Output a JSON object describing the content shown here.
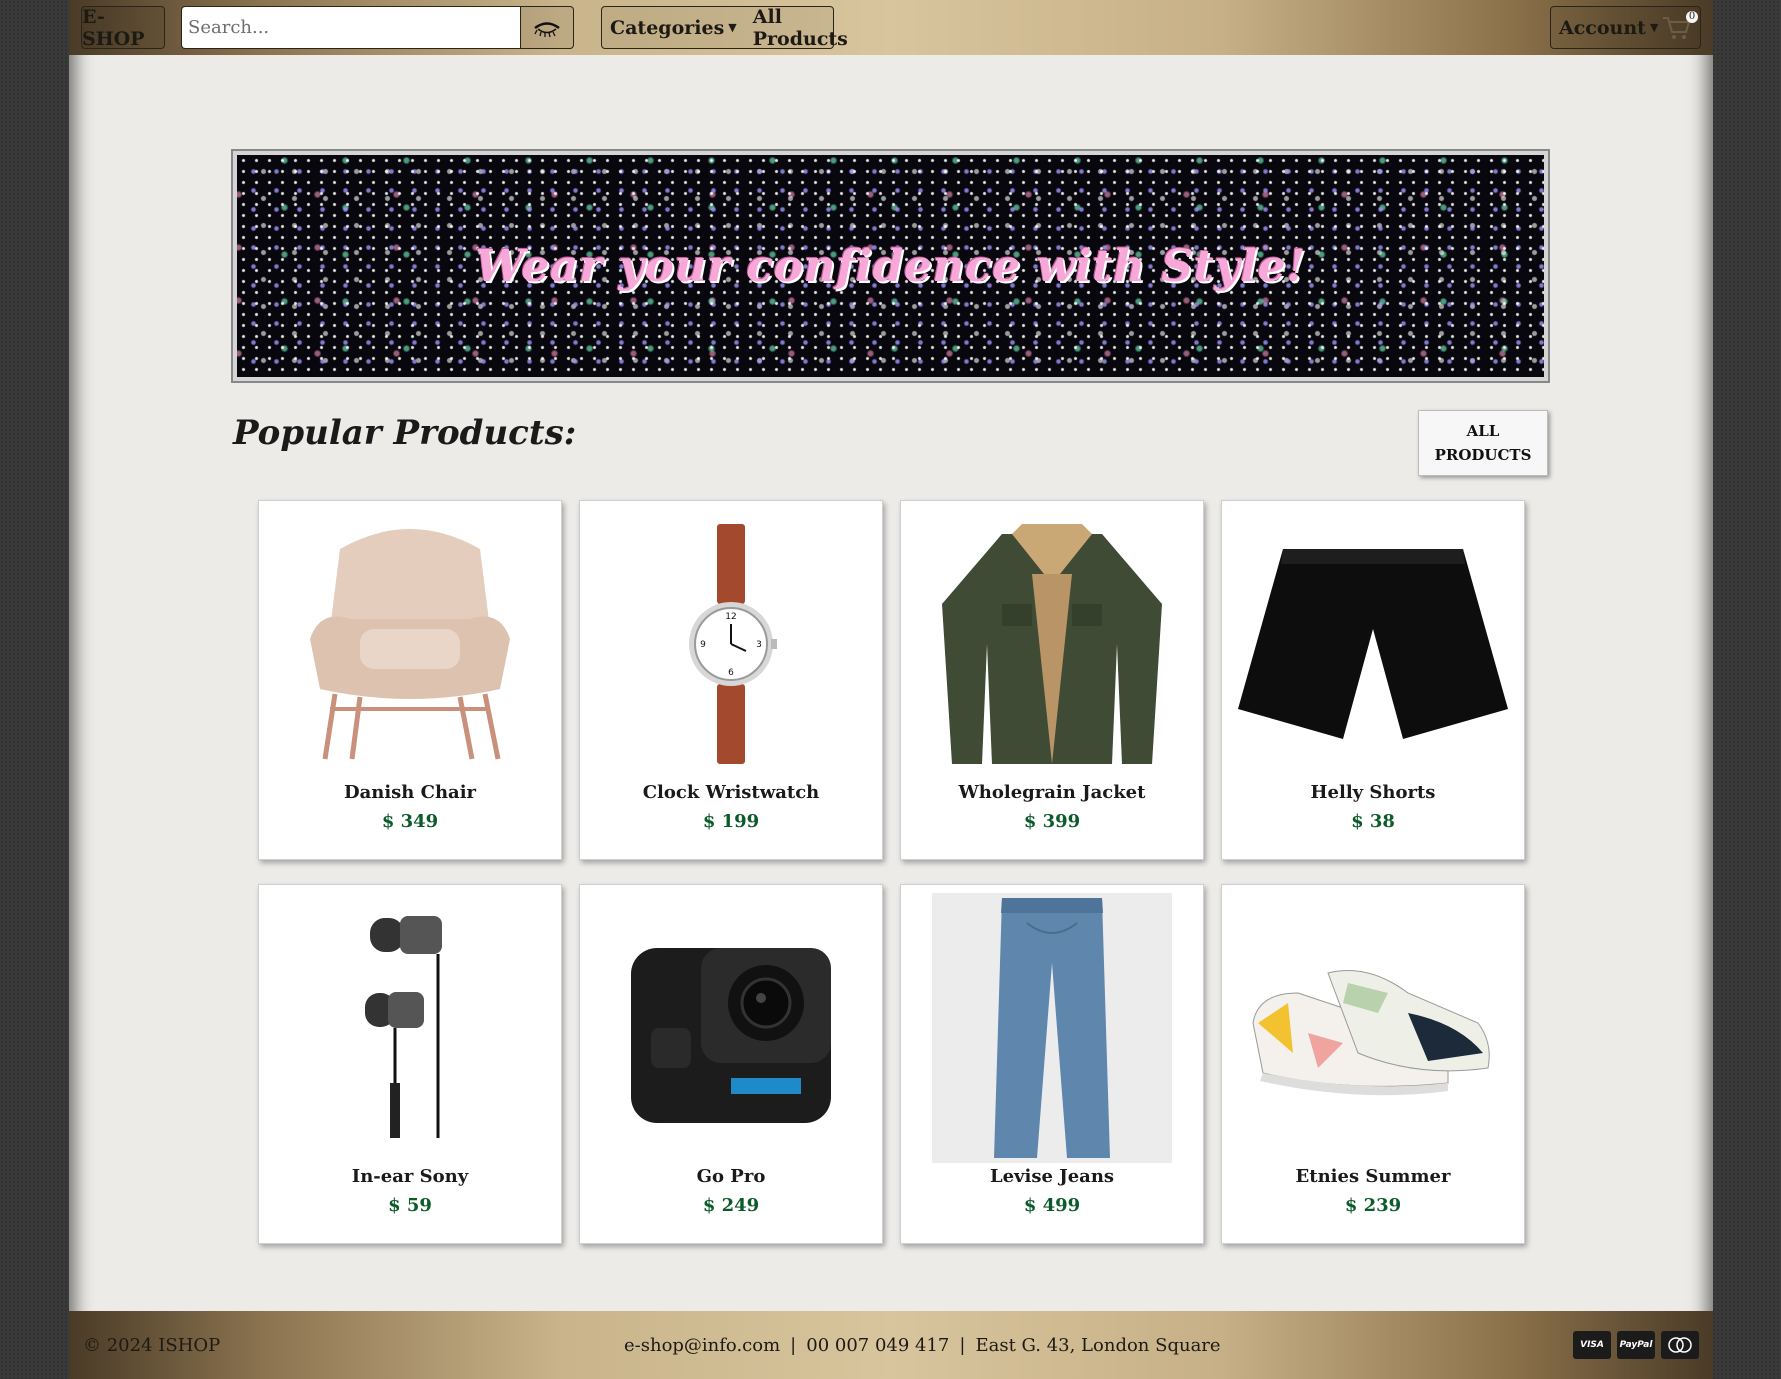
{
  "header": {
    "brand": "E-SHOP",
    "search_placeholder": "Search...",
    "search_icon": "eye-search-icon",
    "nav": {
      "categories": "Categories",
      "all_products": "All Products"
    },
    "account": "Account",
    "cart_count": "0"
  },
  "banner": {
    "tagline": "Wear your confidence with Style!"
  },
  "popular": {
    "title": "Popular Products:",
    "all_button": "ALL PRODUCTS",
    "products": [
      {
        "name": "Danish Chair",
        "price": "$ 349",
        "icon": "chair-image"
      },
      {
        "name": "Clock Wristwatch",
        "price": "$ 199",
        "icon": "watch-image"
      },
      {
        "name": "Wholegrain Jacket",
        "price": "$ 399",
        "icon": "jacket-image"
      },
      {
        "name": "Helly Shorts",
        "price": "$ 38",
        "icon": "shorts-image"
      },
      {
        "name": "In-ear Sony",
        "price": "$ 59",
        "icon": "earphones-image"
      },
      {
        "name": "Go Pro",
        "price": "$ 249",
        "icon": "camera-image"
      },
      {
        "name": "Levise Jeans",
        "price": "$ 499",
        "icon": "jeans-image"
      },
      {
        "name": "Etnies Summer",
        "price": "$ 239",
        "icon": "sneakers-image"
      }
    ]
  },
  "footer": {
    "copyright": "© 2024 ISHOP",
    "email": "e-shop@info.com",
    "sep": "|",
    "phone": "00 007 049 417",
    "address": "East G. 43, London Square",
    "payments": [
      "VISA",
      "PayPal",
      "MC"
    ]
  }
}
